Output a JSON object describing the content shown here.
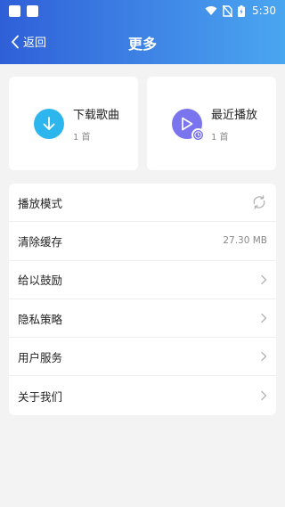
{
  "status_bar": {
    "time": "5:30"
  },
  "nav": {
    "back_label": "返回",
    "title": "更多"
  },
  "cards": [
    {
      "title": "下载歌曲",
      "count": "1 首",
      "icon": "download-arrow-icon",
      "color": "#2db6ee"
    },
    {
      "title": "最近播放",
      "count": "1 首",
      "icon": "play-history-icon",
      "color": "#7b74ef"
    }
  ],
  "settings": [
    {
      "label": "播放模式",
      "value": "",
      "icon": "loop-mode-icon"
    },
    {
      "label": "清除缓存",
      "value": "27.30 MB",
      "icon": ""
    },
    {
      "label": "给以鼓励",
      "value": "",
      "icon": "chevron-right-icon"
    },
    {
      "label": "隐私策略",
      "value": "",
      "icon": "chevron-right-icon"
    },
    {
      "label": "用户服务",
      "value": "",
      "icon": "chevron-right-icon"
    },
    {
      "label": "关于我们",
      "value": "",
      "icon": "chevron-right-icon"
    }
  ],
  "colors": {
    "header_start": "#2f5fd8",
    "header_end": "#4aa6f0",
    "background": "#f3f3f3"
  }
}
